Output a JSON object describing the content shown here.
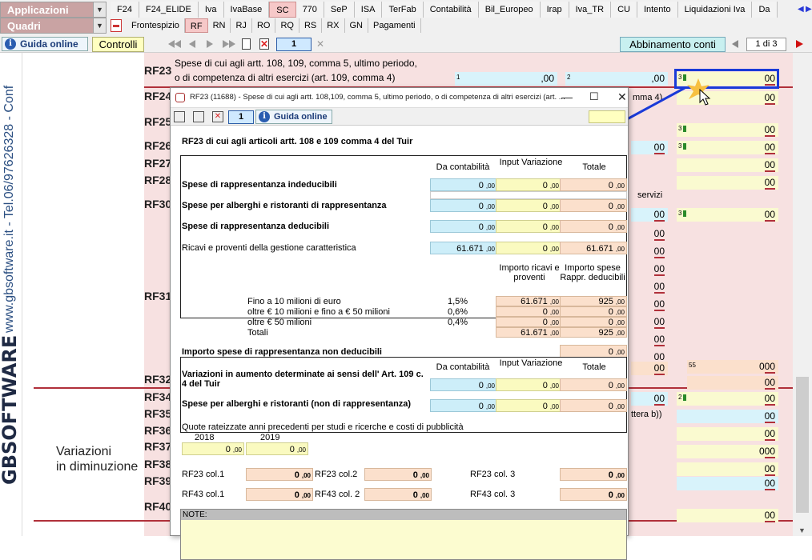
{
  "menus": {
    "applicazioni": "Applicazioni",
    "quadri": "Quadri"
  },
  "tabs_top": [
    "F24",
    "F24_ELIDE",
    "Iva",
    "IvaBase",
    "SC",
    "770",
    "SeP",
    "ISA",
    "TerFab",
    "Contabilità",
    "Bil_Europeo",
    "Irap",
    "Iva_TR",
    "CU",
    "Intento",
    "Liquidazioni Iva",
    "Da"
  ],
  "tabs_top_active": "SC",
  "tabs_quadri": [
    "Frontespizio",
    "RF",
    "RN",
    "RJ",
    "RO",
    "RQ",
    "RS",
    "RX",
    "GN",
    "Pagamenti"
  ],
  "tabs_quadri_active": "RF",
  "toolbar": {
    "guida": "Guida online",
    "controlli": "Controlli",
    "page": "1",
    "abbinamento": "Abbinamento conti",
    "page_of": "1 di 3"
  },
  "sidebar": {
    "phone": "www.gbsoftware.it - Tel.06/97626328 - Conf",
    "logo": "GBSOFTWARE"
  },
  "form": {
    "rf23_desc1": "Spese di cui agli artt. 108, 109, comma 5, ultimo periodo,",
    "rf23_desc2": "o di competenza di altri esercizi (art. 109, comma 4)",
    "rows": [
      "RF23",
      "RF24",
      "RF25",
      "RF26",
      "RF27",
      "RF28",
      "RF30",
      "RF31",
      "RF32",
      "RF34",
      "RF35",
      "RF36",
      "RF37",
      "RF38",
      "RF39",
      "RF40"
    ],
    "var_dim1": "Variazioni",
    "var_dim2": "in diminuzione",
    "rf23_f1": ",00",
    "rf23_f2": ",00",
    "rf23_f3": "00",
    "frag_comma": "mma 4)",
    "frag_servizi": "servizi",
    "frag_lettera": "ttera b))",
    "val_00": "00",
    "val_0": "0",
    "sup_1": "1",
    "sup_2": "2",
    "sup_3": "3",
    "sup_55": "55"
  },
  "popup": {
    "title": "RF23 (11688) - Spese di cui agli artt. 108,109, comma 5, ultimo periodo, o di competenza di altri esercizi (art. ...",
    "page": "1",
    "guida": "Guida online",
    "header": "RF23 di cui agli articoli artt. 108 e  109 comma 4 del Tuir",
    "col_contabilita": "Da contabilità",
    "col_input": "Input Variazione",
    "col_totale": "Totale",
    "rows1": [
      {
        "label": "Spese di rappresentanza indeducibili",
        "a": "0",
        "b": "0",
        "c": "0"
      },
      {
        "label": "Spese per alberghi e ristoranti di rappresentanza",
        "a": "0",
        "b": "0",
        "c": "0"
      },
      {
        "label": "Spese di rappresentanza deducibili",
        "a": "0",
        "b": "0",
        "c": "0"
      },
      {
        "label": "Ricavi e proventi della gestione caratteristica",
        "a": "61.671",
        "b": "0",
        "c": "61.671"
      }
    ],
    "col_importo_ricavi": "Importo ricavi e proventi",
    "col_importo_spese": "Importo spese Rappr. deducibili",
    "scaglioni": [
      {
        "label": "Fino a 10 milioni di euro",
        "pct": "1,5%",
        "ricavi": "61.671",
        "spese": "925"
      },
      {
        "label": "oltre € 10 milioni e fino a € 50 milioni",
        "pct": "0,6%",
        "ricavi": "0",
        "spese": "0"
      },
      {
        "label": "oltre € 50 milioni",
        "pct": "0,4%",
        "ricavi": "0",
        "spese": "0"
      },
      {
        "label": "Totali",
        "pct": "",
        "ricavi": "61.671",
        "spese": "925"
      }
    ],
    "non_deducibili_label": "Importo spese di rappresentanza non deducibili",
    "non_deducibili_val": "0",
    "var_aumento_label": "Variazioni in aumento determinate ai sensi dell' Art. 109 c. 4 del Tuir",
    "var_aumento": {
      "a": "0",
      "b": "0",
      "c": "0"
    },
    "alberghi_non_label": "Spese per alberghi e ristoranti (non di rappresentanza)",
    "alberghi_non": {
      "a": "0",
      "b": "0",
      "c": "0"
    },
    "quote_label": "Quote rateizzate anni precedenti per studi e ricerche e costi di pubblicità",
    "year1": "2018",
    "year2": "2019",
    "year1_val": "0",
    "year2_val": "0",
    "rf23_col1": "RF23 col.1",
    "rf23_col2": "RF23 col.2",
    "rf23_col3": "RF23 col. 3",
    "rf43_col1": "RF43 col.1",
    "rf43_col2": "RF43 col. 2",
    "rf43_col3": "RF43 col. 3",
    "col_vals": {
      "rf23_1": "0",
      "rf23_2": "0",
      "rf23_3": "0",
      "rf43_1": "0",
      "rf43_2": "0",
      "rf43_3": "0"
    },
    "notes": "NOTE:",
    "dec": ",00"
  }
}
